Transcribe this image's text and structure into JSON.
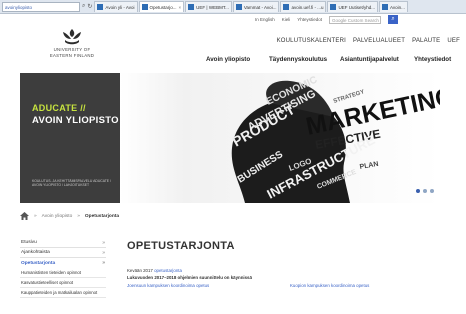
{
  "browser": {
    "address": "avoinyliopisto",
    "tabs": [
      {
        "label": "Avoin yli - Avoi"
      },
      {
        "label": "Opetustarjo...",
        "active": true
      },
      {
        "label": "UEF | WEBMT..."
      },
      {
        "label": "Vammat - Avoi..."
      },
      {
        "label": "avoin.uef.fi - ...u"
      },
      {
        "label": "UEF Uutiset/yhd..."
      },
      {
        "label": "Avoin..."
      }
    ]
  },
  "utility": {
    "links": [
      "In English",
      "Kieli",
      "Yhteystiedot"
    ],
    "search_placeholder": "Google Custom Search"
  },
  "logo": {
    "line1": "UNIVERSITY OF",
    "line2": "EASTERN FINLAND"
  },
  "topnav": [
    "KOULUTUSKALENTERI",
    "PALVELUALUEET",
    "PALAUTE",
    "UEF"
  ],
  "mainnav": [
    "Avoin yliopisto",
    "Täydennyskoulutus",
    "Asiantuntijapalvelut",
    "Yhteystiedot"
  ],
  "hero": {
    "title1": "ADUCATE //",
    "title2": "AVOIN YLIOPISTO",
    "small_text": "KOULUTUS- JA KEHITTÄMISPALVELU ADUCATE / AVOIN YLIOPISTO / LAHJOITUKSET",
    "words": [
      "MARKETING",
      "EFFECTIVE",
      "ADVERTISING",
      "STRATEGY",
      "ECONOMIC",
      "PRODUCT",
      "INFRASTRUCTURE",
      "BUSINESS",
      "COMMERCE",
      "LOGO",
      "PLAN"
    ],
    "slides": 3,
    "active_slide": 1
  },
  "breadcrumb": {
    "items": [
      "Avoin yliopisto",
      "Opetustarjonta"
    ]
  },
  "sidebar": {
    "items": [
      {
        "label": "Etusivu"
      },
      {
        "label": "Ajankohtaista"
      },
      {
        "label": "Opetustarjonta",
        "active": true
      }
    ],
    "subitems": [
      "Humanististen tieteiden opinnot",
      "Kasvatustieteelliset opinnot",
      "Kauppatieteiden ja matkailualan opinnot"
    ]
  },
  "main": {
    "title": "OPETUSTARJONTA",
    "line1_prefix": "Kevään 2017 ",
    "line1_link": "opetustarjonta",
    "line2": "Lukuvuoden 2017–2018 ohjelmien suunnittelu on käynnissä",
    "link_left": "Joensuun kampuksen koordinoima opetus",
    "link_right": "Kuopion kampuksen koordinoima opetus"
  }
}
